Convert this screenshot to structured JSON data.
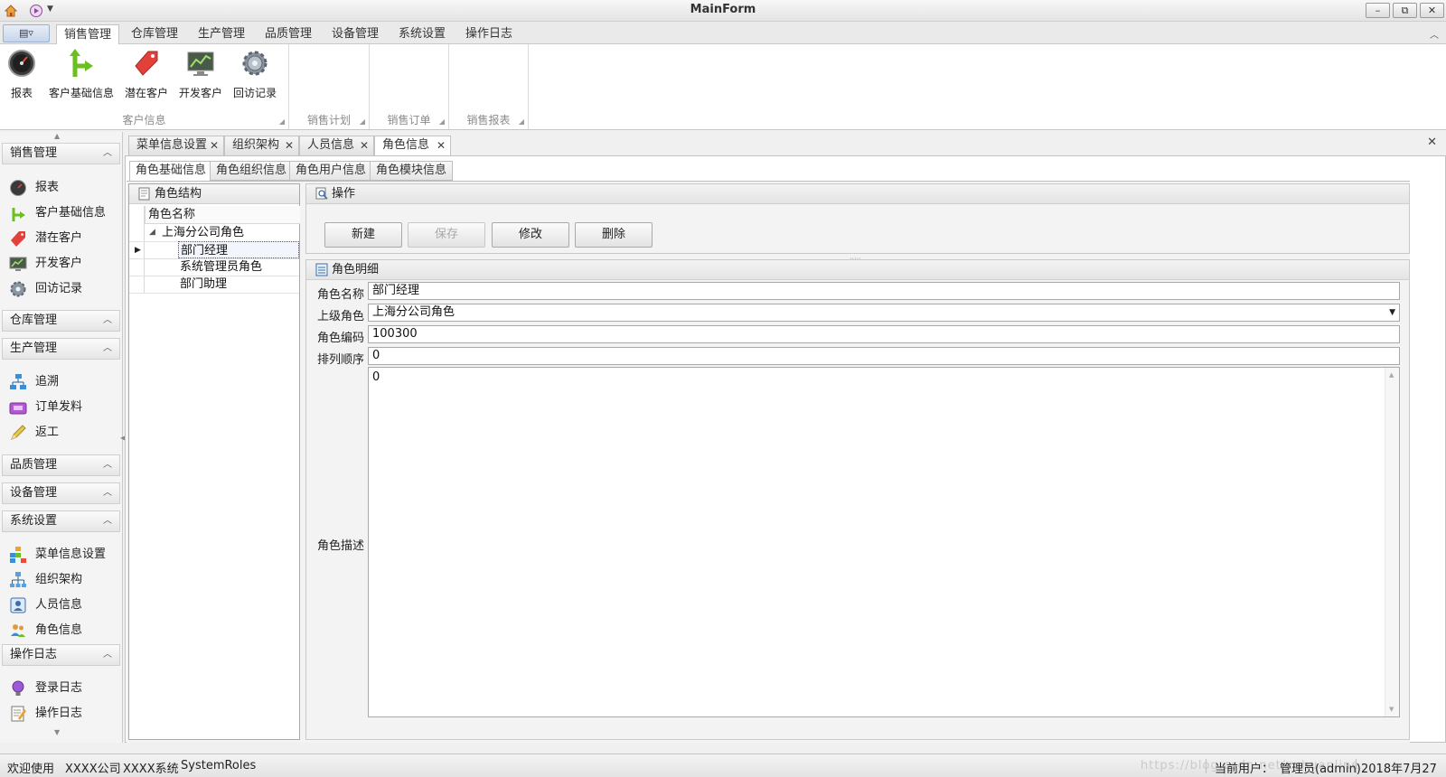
{
  "window": {
    "title": "MainForm",
    "minimize": "–",
    "restore": "⧉",
    "close": "✕"
  },
  "quick_access": {
    "app_icon": "home-icon",
    "customize_icon": "customize-icon"
  },
  "app_menu_button": "▤▿",
  "ribbon": {
    "tabs": [
      "销售管理",
      "仓库管理",
      "生产管理",
      "品质管理",
      "设备管理",
      "系统设置",
      "操作日志"
    ],
    "active_tab": 0,
    "collapse": "︿",
    "groups": [
      {
        "label": "客户信息",
        "buttons": [
          {
            "label": "报表",
            "icon": "gauge-icon"
          },
          {
            "label": "客户基础信息",
            "icon": "fork-arrow-icon"
          },
          {
            "label": "潜在客户",
            "icon": "tag-icon"
          },
          {
            "label": "开发客户",
            "icon": "monitor-chart-icon"
          },
          {
            "label": "回访记录",
            "icon": "gear-icon"
          }
        ]
      },
      {
        "label": "销售计划",
        "buttons": []
      },
      {
        "label": "销售订单",
        "buttons": []
      },
      {
        "label": "销售报表",
        "buttons": []
      }
    ],
    "launcher": "◢"
  },
  "nav": {
    "scroll_up": "▲",
    "scroll_down": "▼",
    "collapse_glyph": "︿",
    "groups": [
      {
        "title": "销售管理",
        "items": [
          {
            "label": "报表",
            "icon": "gauge-icon"
          },
          {
            "label": "客户基础信息",
            "icon": "fork-arrow-icon"
          },
          {
            "label": "潜在客户",
            "icon": "tag-icon"
          },
          {
            "label": "开发客户",
            "icon": "monitor-chart-icon"
          },
          {
            "label": "回访记录",
            "icon": "gear-icon"
          }
        ]
      },
      {
        "title": "仓库管理",
        "items": []
      },
      {
        "title": "生产管理",
        "items": [
          {
            "label": "追溯",
            "icon": "network-icon"
          },
          {
            "label": "订单发料",
            "icon": "order-box-icon"
          },
          {
            "label": "返工",
            "icon": "pencil-icon"
          }
        ]
      },
      {
        "title": "品质管理",
        "items": []
      },
      {
        "title": "设备管理",
        "items": []
      },
      {
        "title": "系统设置",
        "items": [
          {
            "label": "菜单信息设置",
            "icon": "menu-blocks-icon"
          },
          {
            "label": "组织架构",
            "icon": "org-chart-icon"
          },
          {
            "label": "人员信息",
            "icon": "person-card-icon"
          },
          {
            "label": "角色信息",
            "icon": "users-icon"
          }
        ]
      },
      {
        "title": "操作日志",
        "items": [
          {
            "label": "登录日志",
            "icon": "bulb-icon"
          },
          {
            "label": "操作日志",
            "icon": "notepad-icon"
          }
        ]
      }
    ]
  },
  "doc_tabs": [
    {
      "label": "菜单信息设置",
      "close": "✕"
    },
    {
      "label": "组织架构",
      "close": "✕"
    },
    {
      "label": "人员信息",
      "close": "✕"
    },
    {
      "label": "角色信息",
      "close": "✕"
    }
  ],
  "doc_tabs_active": 3,
  "doc_close_all": "✕",
  "sub_tabs": [
    "角色基础信息",
    "角色组织信息",
    "角色用户信息",
    "角色模块信息"
  ],
  "sub_tabs_active": 0,
  "tree": {
    "panel_title": "角色结构",
    "column": "角色名称",
    "root": {
      "label": "上海分公司角色",
      "expander": "◢"
    },
    "children": [
      "部门经理",
      "系统管理员角色",
      "部门助理"
    ],
    "selected_index": 0,
    "row_indicator": "▶"
  },
  "ops": {
    "panel_title": "操作",
    "buttons": [
      {
        "label": "新建",
        "enabled": true
      },
      {
        "label": "保存",
        "enabled": false
      },
      {
        "label": "修改",
        "enabled": true
      },
      {
        "label": "删除",
        "enabled": true
      }
    ]
  },
  "detail": {
    "panel_title": "角色明细",
    "fields": {
      "name": {
        "label": "角色名称",
        "value": "部门经理"
      },
      "parent": {
        "label": "上级角色",
        "value": "上海分公司角色",
        "dropdown": "▼"
      },
      "code": {
        "label": "角色编码",
        "value": "100300"
      },
      "order": {
        "label": "排列顺序",
        "value": "0"
      },
      "description": {
        "label": "角色描述",
        "value": "0"
      }
    },
    "scroll_up": "▲",
    "scroll_down": "▼"
  },
  "splitter_grip": "⋮",
  "hsplitter_grip": "·····",
  "status": {
    "welcome": "欢迎使用",
    "company": "XXXX公司",
    "system": "XXXX系统",
    "module": "SystemRoles",
    "watermark": "https://blog.csdn.net/zuhuanline",
    "user_label": "当前用户：",
    "user": "管理员(admin)",
    "date": "2018年7月27日"
  }
}
